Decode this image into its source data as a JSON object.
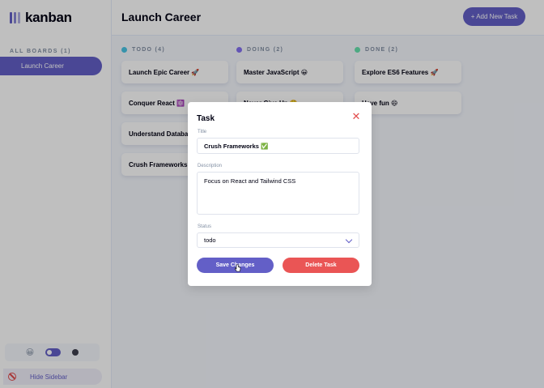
{
  "app": {
    "logo_text": "kanban"
  },
  "sidebar": {
    "boards_heading": "ALL BOARDS (1)",
    "boards": [
      {
        "label": "Launch Career"
      }
    ],
    "theme": {
      "light_icon": "😀",
      "dark_icon": "moon-icon",
      "toggle_on": true
    },
    "hide_label": "Hide Sidebar"
  },
  "header": {
    "board_title": "Launch Career",
    "add_task_label": "+ Add New Task"
  },
  "columns": [
    {
      "label": "TODO (4)",
      "color": "#49c4e5",
      "cards": [
        "Launch Epic Career 🚀",
        "Conquer React ⚛️",
        "Understand Databases",
        "Crush Frameworks ✅"
      ]
    },
    {
      "label": "DOING (2)",
      "color": "#8471f2",
      "cards": [
        "Master JavaScript 😀",
        "Never Give Up 😤"
      ]
    },
    {
      "label": "DONE (2)",
      "color": "#67e2ae",
      "cards": [
        "Explore ES6 Features 🚀",
        "Have fun 😄"
      ]
    }
  ],
  "modal": {
    "heading": "Task",
    "title_label": "Title",
    "title_value": "Crush Frameworks ✅",
    "description_label": "Description",
    "description_value": "Focus on React and Tailwind CSS",
    "status_label": "Status",
    "status_value": "todo",
    "save_label": "Save Changes",
    "delete_label": "Delete Task",
    "close_icon": "✕"
  },
  "colors": {
    "accent": "#635fc7",
    "danger": "#ea5555"
  }
}
